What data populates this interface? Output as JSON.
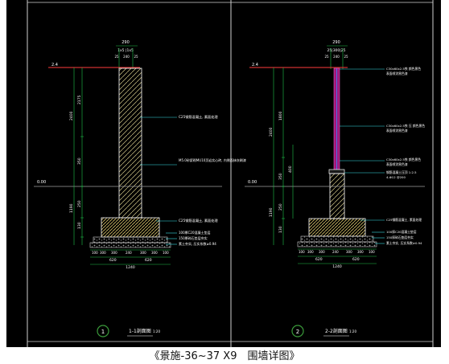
{
  "caption": "《景施-36~37 X9　围墙详图》",
  "colors": {
    "background": "#000000",
    "frame": "#ffffff",
    "wall": "#ff3b3b",
    "dimension": "#1fc14a",
    "leader": "#3ae0e6",
    "hatch": "#d4c98a",
    "gravel": "#8c8c8c",
    "column": "#a0157a",
    "ground": "#3a8cff"
  },
  "detail1": {
    "top_dims": {
      "overall": "290",
      "parts": "1x5 |1x5",
      "left": "25",
      "mid": "240",
      "right": "25"
    },
    "top_level": "2.4",
    "ground_level": "0.00",
    "vertical_dims": [
      "2400",
      "2175",
      "1190",
      "350",
      "250",
      "130"
    ],
    "notes": [
      "C25钢筋混凝土, 素面处理",
      "M5.0砂浆砌MU10页岩实心砖, 内侧面抹灰刷漆",
      "C25钢筋混凝土, 素面处理",
      "100厚C20混凝土垫层",
      "150厚碎石垫层夯实",
      "素土夯实, 压实系数≥0.94"
    ],
    "bottom_dims": [
      "100",
      "300",
      "300",
      "240",
      "300",
      "300",
      "100"
    ],
    "bottom_sub": [
      "620",
      "620"
    ],
    "bottom_total": "1240",
    "section_no": "1",
    "section_title": "1-1剖面图",
    "scale": "1:20"
  },
  "detail2": {
    "top_dims": {
      "overall": "290",
      "parts": "25|300|25",
      "left": "25",
      "mid": "240",
      "right": "25"
    },
    "top_level": "2.4",
    "ground_level": "0.00",
    "vertical_dims": [
      "2400",
      "1800",
      "400",
      "350",
      "1190",
      "250",
      "130"
    ],
    "notes": [
      "C30x60x2.5铁 颜色黑色",
      "表面喷涂黑色漆",
      "C30x60x2.5铁 压 颜色黑色",
      "表面喷涂黑色漆",
      "C30x60x2.5铁 颜色黑色",
      "表面喷涂黑色漆",
      "钢筋混凝土压顶 1:2.5",
      "4-Φ12 @200",
      "C25钢筋混凝土, 素面处理",
      "100厚C20混凝土垫层",
      "150厚碎石垫层夯实",
      "素土夯实, 压实系数≥0.94"
    ],
    "bottom_dims": [
      "100",
      "300",
      "300",
      "240",
      "300",
      "300",
      "100"
    ],
    "bottom_sub": [
      "620",
      "620"
    ],
    "bottom_total": "1240",
    "section_no": "2",
    "section_title": "2-2剖面图",
    "scale": "1:20"
  }
}
